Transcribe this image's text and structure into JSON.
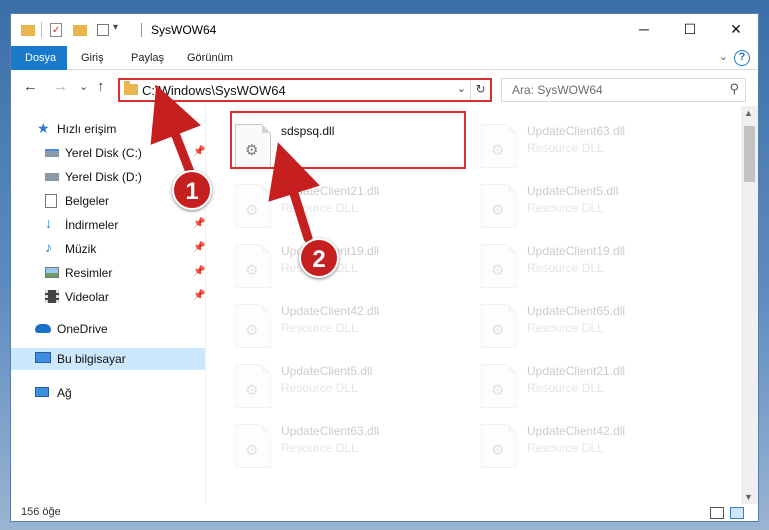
{
  "window": {
    "title": "SysWOW64",
    "controls": {
      "minimize": "─",
      "maximize": "☐",
      "close": "✕"
    }
  },
  "ribbon": {
    "tabs": [
      {
        "label": "Dosya",
        "active": true
      },
      {
        "label": "Giriş",
        "active": false
      },
      {
        "label": "Paylaş",
        "active": false
      },
      {
        "label": "Görünüm",
        "active": false
      }
    ],
    "help": "?",
    "expand": "⌄"
  },
  "nav": {
    "back": "←",
    "forward": "→",
    "recent": "⌄",
    "up": "↑",
    "address": "C:\\Windows\\SysWOW64",
    "address_dropdown": "⌄",
    "refresh": "↻",
    "search_placeholder": "Ara: SysWOW64",
    "search_icon": "⚲"
  },
  "sidebar": {
    "items": [
      {
        "label": "Hızlı erişim",
        "icon": "star-icon",
        "pinned": false
      },
      {
        "label": "Yerel Disk (C:)",
        "icon": "drive-icon",
        "pinned": true
      },
      {
        "label": "Yerel Disk (D:)",
        "icon": "drive-icon",
        "pinned": false
      },
      {
        "label": "Belgeler",
        "icon": "documents-icon",
        "pinned": true
      },
      {
        "label": "İndirmeler",
        "icon": "download-icon",
        "pinned": true
      },
      {
        "label": "Müzik",
        "icon": "music-icon",
        "pinned": true
      },
      {
        "label": "Resimler",
        "icon": "pictures-icon",
        "pinned": true
      },
      {
        "label": "Videolar",
        "icon": "video-icon",
        "pinned": true
      },
      {
        "label": "OneDrive",
        "icon": "cloud-icon",
        "pinned": false
      },
      {
        "label": "Bu bilgisayar",
        "icon": "computer-icon",
        "pinned": false,
        "selected": true
      },
      {
        "label": "Ağ",
        "icon": "network-icon",
        "pinned": false
      }
    ],
    "pin_glyph": "📌"
  },
  "files": {
    "column_left": [
      {
        "name": "sdspsq.dll",
        "type": ""
      },
      {
        "name": "UpdateClient21.dll",
        "type": "Resource DLL"
      },
      {
        "name": "UpdateClient19.dll",
        "type": "Resource DLL"
      },
      {
        "name": "UpdateClient42.dll",
        "type": "Resource DLL"
      },
      {
        "name": "UpdateClient5.dll",
        "type": "Resource DLL"
      },
      {
        "name": "UpdateClient63.dll",
        "type": "Resource DLL"
      }
    ],
    "column_right": [
      {
        "name": "UpdateClient63.dll",
        "type": "Resource DLL"
      },
      {
        "name": "UpdateClient5.dll",
        "type": "Resource DLL"
      },
      {
        "name": "UpdateClient19.dll",
        "type": "Resource DLL"
      },
      {
        "name": "UpdateClient65.dll",
        "type": "Resource DLL"
      },
      {
        "name": "UpdateClient21.dll",
        "type": "Resource DLL"
      },
      {
        "name": "UpdateClient42.dll",
        "type": "Resource DLL"
      }
    ],
    "gear_glyph": "⚙"
  },
  "status": {
    "count": "156 öğe"
  },
  "annotations": {
    "step1": "1",
    "step2": "2",
    "accent": "#c61f1f"
  }
}
